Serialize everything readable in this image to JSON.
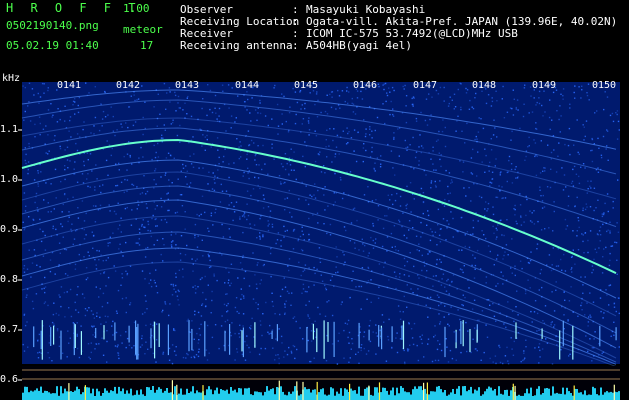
{
  "header": {
    "app_name": "H R O F F T",
    "version": "1.00",
    "filename": "0502190140.png",
    "meteor_label": "meteor",
    "meteor_count": "17",
    "datetime": "05.02.19 01:40"
  },
  "info": {
    "rows": [
      {
        "key": "Observer",
        "value": "Masayuki Kobayashi"
      },
      {
        "key": "Receiving Location",
        "value": "Ogata-vill. Akita-Pref. JAPAN (139.96E, 40.02N)"
      },
      {
        "key": "Receiver",
        "value": "ICOM IC-575 53.7492(@LCD)MHz USB"
      },
      {
        "key": "Receiving antenna",
        "value": "A504HB(yagi 4el)"
      }
    ],
    "separator": ":"
  },
  "chart_data": {
    "type": "heatmap",
    "ylabel": "kHz",
    "y_ticks": [
      "1.1",
      "1.0",
      "0.9",
      "0.8",
      "0.7",
      "0.6"
    ],
    "x_ticks": [
      "0141",
      "0142",
      "0143",
      "0144",
      "0145",
      "0146",
      "0147",
      "0148",
      "0149",
      "0150"
    ],
    "background_color": "#001a6e",
    "trace_color": "#66ffcc",
    "noise_color": "#2a6bff",
    "bottom_strip_color": "#22ccee"
  }
}
